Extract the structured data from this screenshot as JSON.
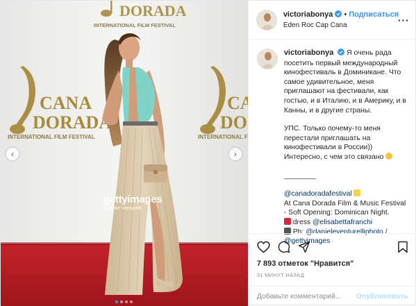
{
  "post": {
    "username": "victoriabonya",
    "verified_badge": "verified-icon",
    "follow_label": "Подписаться",
    "separator": "•",
    "location": "Eden Roc Cap Cana",
    "more_icon": "ellipsis-icon"
  },
  "photo": {
    "watermark_main": "gettyimages",
    "watermark_sub": "Daniele Venturelli",
    "backdrop_text_1": "CANA",
    "backdrop_text_2": "DORADA",
    "backdrop_text_3": "INTERNATIONAL FILM FESTIVAL",
    "prev_icon": "chevron-left-icon",
    "next_icon": "chevron-right-icon",
    "prev_glyph": "‹",
    "next_glyph": "›",
    "carousel_slides": 4,
    "active_slide": 1
  },
  "caption": {
    "username": "victoriabonya",
    "p1": "Я очень рада посетить первый международный кинофестиваль в Доминикане. Что самое удивительное, меня приглашают на фестивали, как гостью, и в Италию, и в Америку, и в Канны, и в другие страны.",
    "p2": "УПС. Только почему-то меня перестали приглашать на кинофестивали в России)) Интересно, с чем это связано",
    "divider": "________",
    "mention_festival": "@canadoradafestival",
    "p3": "At Cana Dorada Film & Music Festival - Soft Opening: Dominican Night.",
    "dress_label": " dress ",
    "mention_dress": "@elisabettafranchi",
    "ph_label": " Ph: ",
    "mention_ph": "@danieleventurelliphoto",
    "slash": " /",
    "mention_getty": "@gettyimages"
  },
  "actions": {
    "like_icon": "heart-icon",
    "comment_icon": "comment-icon",
    "share_icon": "share-icon",
    "save_icon": "bookmark-icon",
    "likes": "7 893 отметок \"Нравится\"",
    "time": "31 МИНУТ НАЗАД"
  },
  "comment_box": {
    "placeholder": "Добавьте комментарий...",
    "publish_label": "Опубликовать"
  },
  "colors": {
    "accent": "#3897f0",
    "link": "#003569",
    "publish_disabled": "#b2dffc",
    "carpet": "#b81d24",
    "dress": "#d8c6a8",
    "dress_top": "#7fd3c6"
  }
}
